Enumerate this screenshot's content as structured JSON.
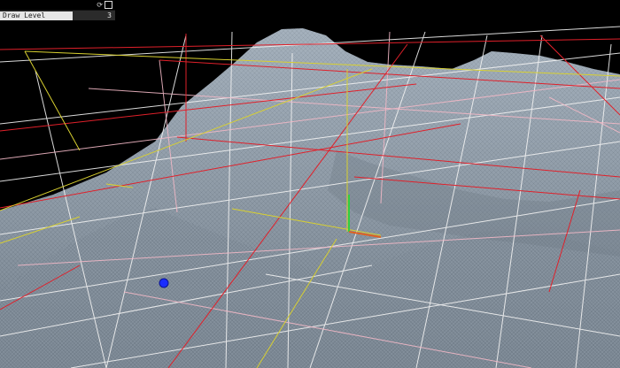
{
  "gui": {
    "settings_icon": "refresh-icon",
    "save_icon": "save-icon",
    "fields": [
      {
        "label": "Draw Level",
        "value": "3"
      }
    ]
  },
  "scene": {
    "background": "#000000",
    "terrain_color": "#9aa7b3",
    "grid_colors": {
      "white": "#f2f2f2",
      "pink": "#f2b8c6",
      "red": "#e0202a",
      "yellow": "#d8d030"
    },
    "marker_color": "#1a2cff"
  }
}
